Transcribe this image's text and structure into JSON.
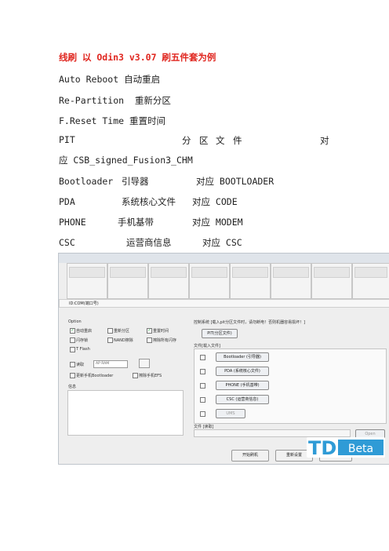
{
  "heading": "线刷 以 Odin3 v3.07 刷五件套为例",
  "options_intro": [
    "Auto Reboot 自动重启",
    "Re-Partition  重新分区",
    "F.Reset Time 重置时间"
  ],
  "pit_line": {
    "label": "PIT",
    "chars": [
      "分",
      "区",
      "文",
      "件"
    ],
    "dui": "对",
    "continuation": "应 CSB_signed_Fusion3_CHM"
  },
  "mappings": [
    {
      "name": "Bootloader",
      "desc": "引导器",
      "target": "对应 BOOTLOADER"
    },
    {
      "name": "PDA",
      "desc": "系统核心文件",
      "target": "对应 CODE"
    },
    {
      "name": "PHONE",
      "desc": "手机基带",
      "target": "对应 MODEM"
    },
    {
      "name": "CSC",
      "desc": "运营商信息",
      "target": "对应 CSC"
    }
  ],
  "odin": {
    "id_com": "ID:COM(端口号)",
    "option_label": "Option",
    "options": [
      {
        "label": "自动重启",
        "checked": true
      },
      {
        "label": "重新分区",
        "checked": false
      },
      {
        "label": "重置时间",
        "checked": true
      },
      {
        "label": "闪存锁",
        "checked": false
      },
      {
        "label": "NAND擦除",
        "checked": false
      },
      {
        "label": "擦除所有闪存",
        "checked": false
      },
      {
        "label": "T Flash",
        "checked": false
      }
    ],
    "dump_label": "读取",
    "dump_select": "AP RAM",
    "phone_bootloader": "更新手机Bootloader",
    "phone_efs": "擦除手机EFS",
    "message_label": "信息",
    "control_text": "控制系统 [载入pit分区文件时，请勿断电！否则机器容易损坏！]",
    "pit_button": "PIT(分区文件)",
    "files_label": "文件[载入文件]",
    "file_buttons": [
      "Bootloader (引导器)",
      "PDA (系统核心文件)",
      "PHONE (手机基带)",
      "CSC (运营商信息)"
    ],
    "ums_button": "UMS",
    "file_read_label": "文件 [读取]",
    "open_button": "Open",
    "start_button": "开始刷机",
    "reset_button": "重新设置",
    "exit_button": "退出"
  },
  "watermark": {
    "brand": "TD",
    "badge": "Beta"
  }
}
